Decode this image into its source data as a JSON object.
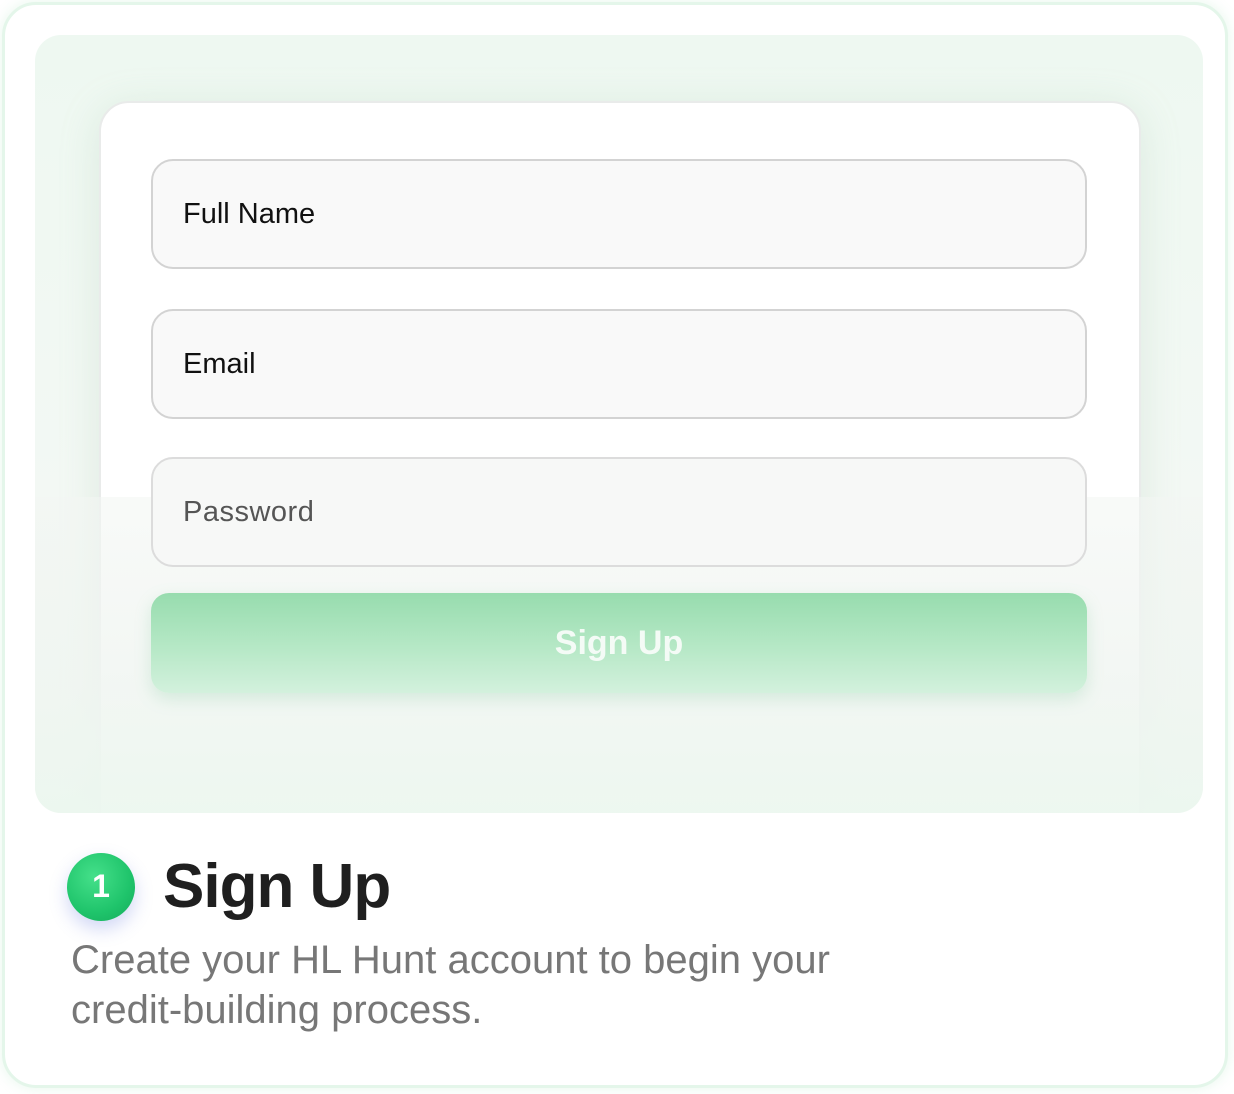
{
  "form": {
    "full_name_placeholder": "Full Name",
    "email_placeholder": "Email",
    "password_placeholder": "Password",
    "submit_label": "Sign Up"
  },
  "step": {
    "number": "1",
    "title": "Sign Up",
    "description": "Create your HL Hunt account to begin your credit-building process."
  },
  "colors": {
    "accent_green": "#1fc46b",
    "button_green": "#97dcae",
    "border": "#d3d3d3"
  }
}
